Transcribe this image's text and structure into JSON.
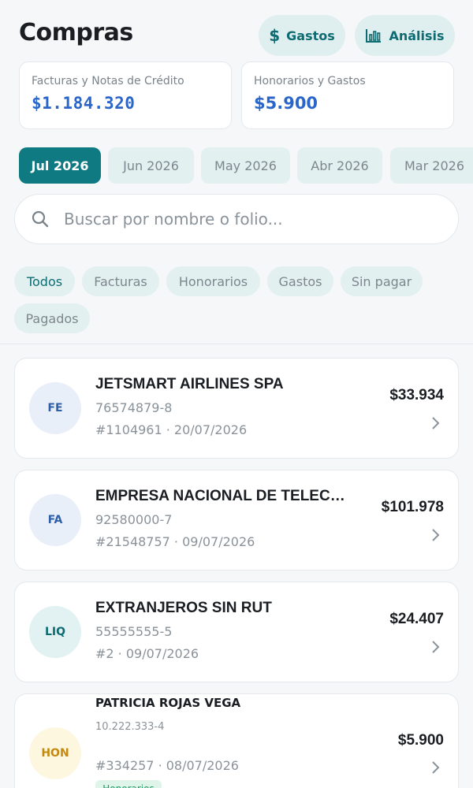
{
  "header": {
    "title": "Compras",
    "gastos_label": "Gastos",
    "gastos_icon": "dollar-icon",
    "analisis_label": "Análisis",
    "analisis_icon": "bar-chart-icon"
  },
  "summary": {
    "left": {
      "label": "Facturas y Notas de Crédito",
      "value": "$1.184.320"
    },
    "right": {
      "label": "Honorarios y Gastos",
      "value": "$5.900"
    }
  },
  "months": [
    "Jul 2026",
    "Jun 2026",
    "May 2026",
    "Abr 2026",
    "Mar 2026"
  ],
  "active_month": "Jul 2026",
  "search": {
    "placeholder": "Buscar por nombre o folio..."
  },
  "filters": [
    "Todos",
    "Facturas",
    "Honorarios",
    "Gastos",
    "Sin pagar",
    "Pagados"
  ],
  "active_filter": "Todos",
  "documents": [
    {
      "type": "FE",
      "name": "JETSMART AIRLINES SPA",
      "rut": "76574879-8",
      "folio": "#1104961 · 20/07/2026",
      "amount": "$33.934"
    },
    {
      "type": "FA",
      "name": "EMPRESA NACIONAL DE TELECOMUNICACIONES",
      "rut": "92580000-7",
      "folio": "#21548757 · 09/07/2026",
      "amount": "$101.978"
    },
    {
      "type": "LIQ",
      "name": "EXTRANJEROS SIN RUT",
      "rut": "55555555-5",
      "folio": "#2 · 09/07/2026",
      "amount": "$24.407"
    },
    {
      "type": "HON",
      "name": "PATRICIA ROJAS VEGA",
      "rut": "10.222.333-4",
      "folio": "#334257 · 08/07/2026",
      "amount": "$5.900",
      "badge": "Honorarios"
    }
  ],
  "colors": {
    "accent": "#0f7a82",
    "summary_value": "#2a66c9",
    "chip_bg": "#e3f0f0"
  }
}
